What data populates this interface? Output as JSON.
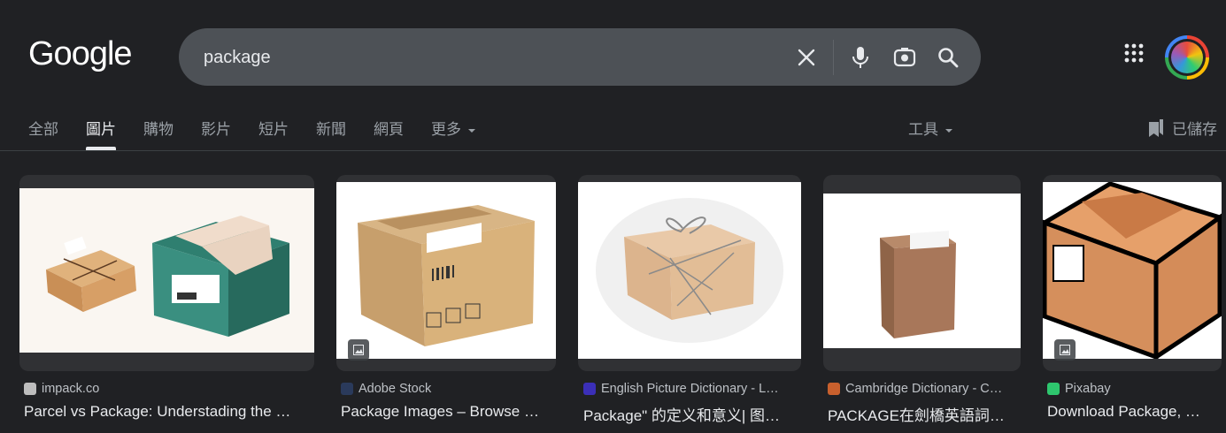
{
  "header": {
    "logo_text": "Google",
    "search_value": "package"
  },
  "tabs": [
    "全部",
    "圖片",
    "購物",
    "影片",
    "短片",
    "新聞",
    "網頁",
    "更多"
  ],
  "active_tab": "圖片",
  "tools_label": "工具",
  "saved_label": "已儲存",
  "results": [
    {
      "source": "impack.co",
      "title": "Parcel vs Package: Understading the …"
    },
    {
      "source": "Adobe Stock",
      "title": "Package Images – Browse …"
    },
    {
      "source": "English Picture Dictionary - L…",
      "title": "Package\" 的定义和意义| 图…"
    },
    {
      "source": "Cambridge Dictionary - C…",
      "title": "PACKAGE在劍橋英語詞…"
    },
    {
      "source": "Pixabay",
      "title": "Download Package, …"
    }
  ],
  "colors": {
    "background": "#202124",
    "search_bg": "#4d5156",
    "text": "#e8eaed",
    "muted": "#9aa0a6"
  }
}
